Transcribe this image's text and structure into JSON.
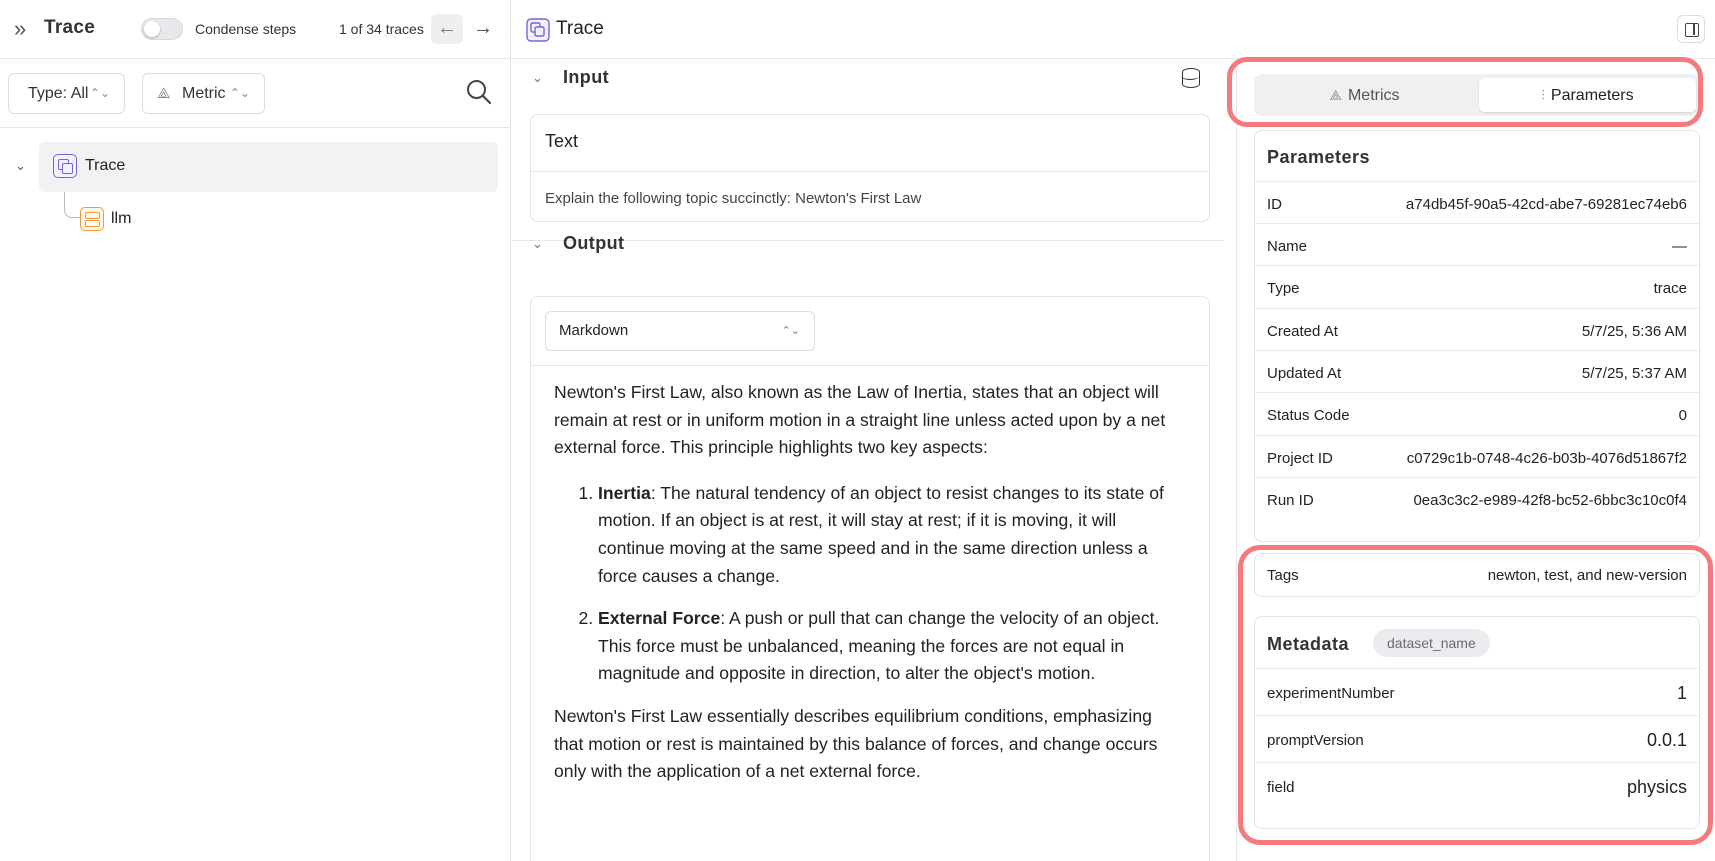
{
  "left": {
    "title": "Trace",
    "toggle_label": "Condense steps",
    "trace_count": "1 of 34 traces",
    "filters": {
      "type": "Type: All",
      "metric": "Metric"
    },
    "tree": {
      "root": "Trace",
      "child": "llm"
    }
  },
  "main": {
    "title": "Trace",
    "input": {
      "heading": "Input",
      "kind": "Text",
      "text": "Explain the following topic succinctly: Newton's First Law"
    },
    "output": {
      "heading": "Output",
      "format": "Markdown",
      "intro": "Newton's First Law, also known as the Law of Inertia, states that an object will remain at rest or in uniform motion in a straight line unless acted upon by a net external force. This principle highlights two key aspects:",
      "items": [
        {
          "term": "Inertia",
          "text": ": The natural tendency of an object to resist changes to its state of motion. If an object is at rest, it will stay at rest; if it is moving, it will continue moving at the same speed and in the same direction unless a force causes a change."
        },
        {
          "term": "External Force",
          "text": ": A push or pull that can change the velocity of an object. This force must be unbalanced, meaning the forces are not equal in magnitude and opposite in direction, to alter the object's motion."
        }
      ],
      "outro": "Newton's First Law essentially describes equilibrium conditions, emphasizing that motion or rest is maintained by this balance of forces, and change occurs only with the application of a net external force."
    }
  },
  "right": {
    "tabs": {
      "metrics": "Metrics",
      "parameters": "Parameters"
    },
    "parameters": {
      "title": "Parameters",
      "rows": [
        {
          "key": "ID",
          "value": "a74db45f-90a5-42cd-abe7-69281ec74eb6"
        },
        {
          "key": "Name",
          "value": "—"
        },
        {
          "key": "Type",
          "value": "trace"
        },
        {
          "key": "Created At",
          "value": "5/7/25, 5:36 AM"
        },
        {
          "key": "Updated At",
          "value": "5/7/25, 5:37 AM"
        },
        {
          "key": "Status Code",
          "value": "0"
        },
        {
          "key": "Project ID",
          "value": "c0729c1b-0748-4c26-b03b-4076d51867f2"
        },
        {
          "key": "Run ID",
          "value": "0ea3c3c2-e989-42f8-bc52-6bbc3c10c0f4"
        }
      ]
    },
    "tags": {
      "key": "Tags",
      "value": "newton, test, and new-version"
    },
    "metadata": {
      "title": "Metadata",
      "badge": "dataset_name",
      "rows": [
        {
          "key": "experimentNumber",
          "value": "1"
        },
        {
          "key": "promptVersion",
          "value": "0.0.1"
        },
        {
          "key": "field",
          "value": "physics"
        }
      ]
    }
  },
  "colors": {
    "accent": "#7a63d6",
    "llm": "#f29a3a",
    "highlight": "#f47a7e"
  }
}
